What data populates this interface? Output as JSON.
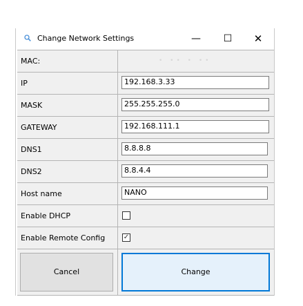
{
  "window": {
    "title": "Change Network Settings",
    "minimize": "—",
    "maximize": "☐",
    "close": "✕"
  },
  "fields": [
    {
      "label": "MAC:",
      "value": "• ••  •  ••"
    },
    {
      "label": "IP",
      "value": "192.168.3.33"
    },
    {
      "label": "MASK",
      "value": "255.255.255.0"
    },
    {
      "label": "GATEWAY",
      "value": "192.168.111.1"
    },
    {
      "label": "DNS1",
      "value": "8.8.8.8"
    },
    {
      "label": "DNS2",
      "value": "8.8.4.4"
    },
    {
      "label": "Host name",
      "value": "NANO"
    },
    {
      "label": "Enable DHCP",
      "checked": false
    },
    {
      "label": "Enable Remote Config",
      "checked": true
    }
  ],
  "buttons": {
    "cancel": "Cancel",
    "change": "Change"
  },
  "colors": {
    "accent": "#0078d7",
    "panel": "#f0f0f0"
  }
}
